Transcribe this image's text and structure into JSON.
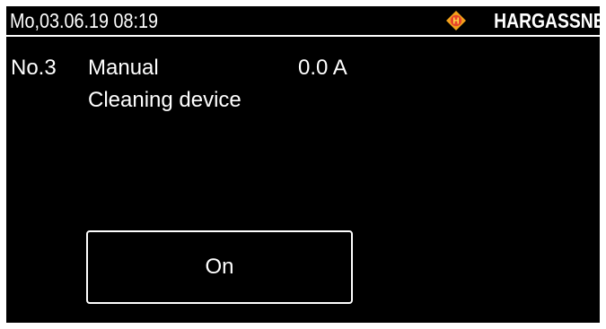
{
  "header": {
    "datetime": "Mo,03.06.19 08:19",
    "brand": "HARGASSNER",
    "logo_icon": "hargassner-logo-icon",
    "logo_color": "#f2a11b",
    "logo_letter": "H"
  },
  "device": {
    "number": "No.3",
    "mode": "Manual",
    "current": "0.0 A",
    "name": "Cleaning device"
  },
  "controls": {
    "toggle_label": "On"
  },
  "colors": {
    "background": "#000000",
    "text": "#ffffff"
  }
}
